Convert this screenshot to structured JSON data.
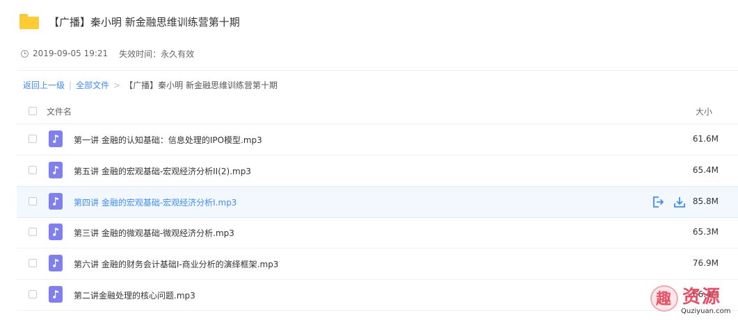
{
  "share": {
    "title": "【广播】秦小明 新金融思维训练营第十期",
    "date": "2019-09-05 19:21",
    "expire": "失效时间：永久有效"
  },
  "breadcrumb": {
    "back": "返回上一级",
    "sep": "|",
    "all_files": "全部文件",
    "arrow": ">",
    "current": "【广播】秦小明 新金融思维训练营第十期"
  },
  "list": {
    "col_name": "文件名",
    "col_size": "大小",
    "rows": [
      {
        "name": "第一讲 金融的认知基础：信息处理的IPO模型.mp3",
        "size": "61.6M"
      },
      {
        "name": "第五讲 金融的宏观基础-宏观经济分析II(2).mp3",
        "size": "65.4M"
      },
      {
        "name": "第四讲 金融的宏观基础-宏观经济分析I.mp3",
        "size": "85.8M",
        "hover": true
      },
      {
        "name": "第三讲 金融的微观基础-微观经济分析.mp3",
        "size": "65.3M"
      },
      {
        "name": "第六讲 金融的财务会计基础I-商业分析的演绎框架.mp3",
        "size": "76.9M"
      },
      {
        "name": "第二讲金融处理的核心问题.mp3",
        "size": "66.4M"
      }
    ]
  },
  "icons": {
    "folder": "folder-icon",
    "clock": "clock-icon",
    "music": "music-file-icon",
    "share": "share-icon",
    "download": "download-icon"
  },
  "colors": {
    "accent": "#3b8cff",
    "folder": "#ffcc33",
    "music_icon": "#7f7ff0",
    "hover_row": "#f3f8ff"
  },
  "watermark": {
    "logo_char": "趣",
    "brand": "资源",
    "url": "Quziyuan.com"
  }
}
